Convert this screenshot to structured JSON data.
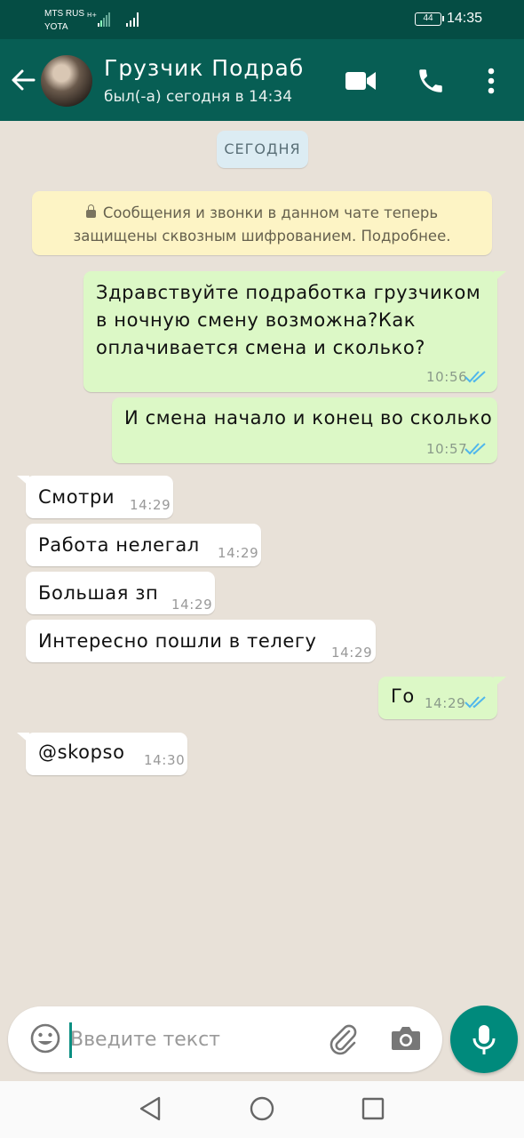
{
  "status_bar": {
    "carrier_1": "MTS RUS",
    "carrier_2": "YOTA",
    "battery": "44",
    "time": "14:35"
  },
  "header": {
    "contact_name": "Грузчик Подраб",
    "last_seen": "был(-а) сегодня в 14:34",
    "icons": [
      "back-arrow-icon",
      "video-call-icon",
      "phone-icon",
      "more-vert-icon"
    ]
  },
  "chat": {
    "day_label": "СЕГОДНЯ",
    "encryption_notice_line1": "Сообщения и звонки в данном чате теперь",
    "encryption_notice_line2": "защищены сквозным шифрованием. Подробнее.",
    "messages": [
      {
        "direction": "out",
        "lines": [
          "Здравствуйте подработка  грузчиком",
          "в ночную смену возможна?Как",
          "оплачивается смена и сколько?"
        ],
        "time": "10:56",
        "status": "read"
      },
      {
        "direction": "out",
        "lines": [
          "И смена начало и конец во сколько"
        ],
        "time": "10:57",
        "status": "read"
      },
      {
        "direction": "in",
        "lines": [
          "Смотри"
        ],
        "time": "14:29"
      },
      {
        "direction": "in",
        "lines": [
          "Работа нелегал"
        ],
        "time": "14:29"
      },
      {
        "direction": "in",
        "lines": [
          "Большая зп"
        ],
        "time": "14:29"
      },
      {
        "direction": "in",
        "lines": [
          "Интересно пошли в телегу"
        ],
        "time": "14:29"
      },
      {
        "direction": "out",
        "lines": [
          "Го"
        ],
        "time": "14:29",
        "status": "read"
      },
      {
        "direction": "in",
        "lines": [
          "@skopso"
        ],
        "time": "14:30"
      }
    ]
  },
  "composer": {
    "placeholder": "Введите текст",
    "value": "",
    "icons": [
      "emoji-icon",
      "attach-icon",
      "camera-icon",
      "mic-icon"
    ]
  },
  "nav_bar": {
    "icons": [
      "back-triangle-icon",
      "home-circle-icon",
      "recents-square-icon"
    ]
  },
  "colors": {
    "header": "#075e54",
    "status_bar": "#054d44",
    "outgoing_bubble": "#dcf8c6",
    "incoming_bubble": "#ffffff",
    "accent": "#008a7c",
    "read_ticks": "#4fb6ec",
    "chat_background": "#e8e1d8"
  }
}
